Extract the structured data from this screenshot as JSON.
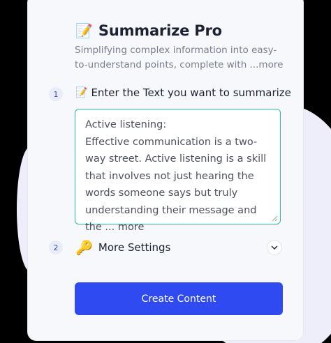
{
  "app": {
    "title_emoji": "📝",
    "title": "Summarize Pro",
    "subtitle": "Simplifying complex information into easy-to-understand points, complete with ",
    "subtitle_more": "...more"
  },
  "step1": {
    "number": "1",
    "emoji": "📝",
    "label": "Enter the Text you want to summarize",
    "text_heading": "Active listening:",
    "text_body": "Effective communication is a two-way street. Active listening is a skill that involves not just hearing the words someone says but truly understanding their message and the ",
    "text_more": "... more"
  },
  "step2": {
    "number": "2",
    "emoji": "🔑",
    "label": "More Settings",
    "chevron_icon": "chevron-down-icon"
  },
  "actions": {
    "create_label": "Create Content"
  },
  "colors": {
    "accent": "#2f4af0",
    "field_border": "#31b8a1",
    "background": "#000000",
    "card": "#f7f8fb"
  }
}
